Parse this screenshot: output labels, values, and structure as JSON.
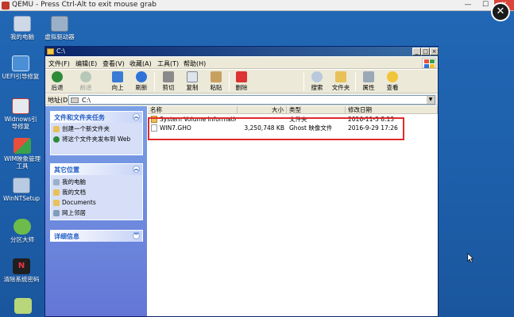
{
  "qemu": {
    "title": "QEMU - Press Ctrl-Alt to exit mouse grab",
    "min": "—",
    "max": "☐",
    "close": "✕"
  },
  "desktop": {
    "icons": [
      {
        "label": "我的电脑"
      },
      {
        "label": "虚拟驱动器"
      },
      {
        "label": "UEFI引导修复"
      },
      {
        "label": "Widnows引导修复"
      },
      {
        "label": "WIM映象管理工具"
      },
      {
        "label": "WinNTSetup"
      },
      {
        "label": "分区大师"
      },
      {
        "label": "清除系统密码"
      }
    ]
  },
  "explorer": {
    "title": "C:\\",
    "menu": [
      "文件(F)",
      "编辑(E)",
      "查看(V)",
      "收藏(A)",
      "工具(T)",
      "帮助(H)"
    ],
    "toolbar": {
      "back": "后退",
      "forward": "前进",
      "up": "向上",
      "refresh": "刷新",
      "cut": "剪切",
      "copy": "复制",
      "paste": "粘贴",
      "delete": "删除",
      "search": "搜索",
      "folders": "文件夹",
      "properties": "属性",
      "views": "查看"
    },
    "address": {
      "label": "地址(D)",
      "value": "C:\\"
    },
    "panels": {
      "tasks": {
        "title": "文件和文件夹任务",
        "links": [
          "创建一个新文件夹",
          "将这个文件夹发布到 Web"
        ]
      },
      "places": {
        "title": "其它位置",
        "links": [
          "我的电脑",
          "我的文档",
          "Documents",
          "网上邻居"
        ]
      },
      "details": {
        "title": "详细信息"
      }
    },
    "columns": {
      "name": "名称",
      "size": "大小",
      "type": "类型",
      "modified": "修改日期"
    },
    "files": [
      {
        "name": "System Volume Information",
        "size": "",
        "type": "文件夹",
        "modified": "2016-11-3 8:13"
      },
      {
        "name": "WIN7.GHO",
        "size": "3,250,748 KB",
        "type": "Ghost 映像文件",
        "modified": "2016-9-29 17:26"
      }
    ]
  },
  "colors": {
    "desktop": "#1d5fa8",
    "highlight": "#e12a2a",
    "panel_title": "#215dc6"
  }
}
